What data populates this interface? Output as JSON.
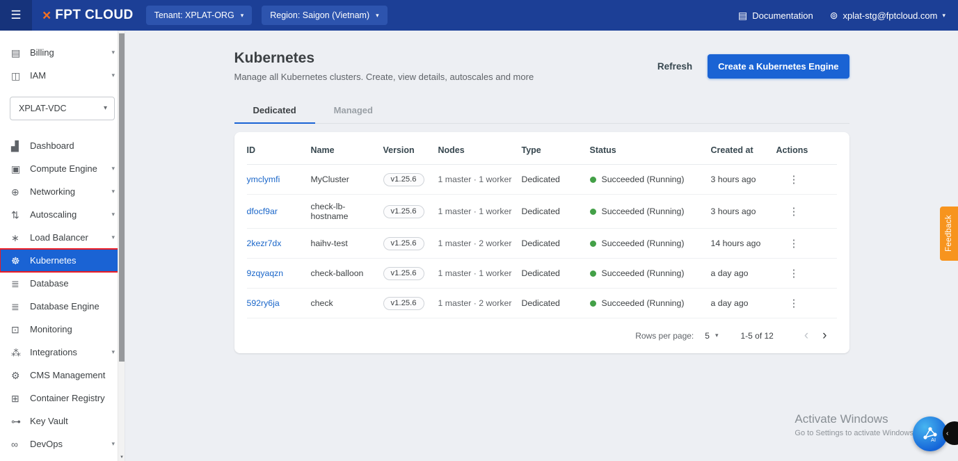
{
  "topbar": {
    "brand": "FPT CLOUD",
    "tenant": "Tenant: XPLAT-ORG",
    "region": "Region: Saigon (Vietnam)",
    "documentation": "Documentation",
    "account": "xplat-stg@fptcloud.com"
  },
  "sidebar": {
    "top_items": [
      {
        "label": "Billing",
        "icon": "billing-icon",
        "expandable": true
      },
      {
        "label": "IAM",
        "icon": "iam-icon",
        "expandable": true
      }
    ],
    "vdc_selector": "XPLAT-VDC",
    "items": [
      {
        "label": "Dashboard",
        "icon": "dashboard-icon"
      },
      {
        "label": "Compute Engine",
        "icon": "compute-icon",
        "expandable": true
      },
      {
        "label": "Networking",
        "icon": "networking-icon",
        "expandable": true
      },
      {
        "label": "Autoscaling",
        "icon": "autoscaling-icon",
        "expandable": true
      },
      {
        "label": "Load Balancer",
        "icon": "loadbalancer-icon",
        "expandable": true
      },
      {
        "label": "Kubernetes",
        "icon": "kubernetes-icon",
        "active": true
      },
      {
        "label": "Database",
        "icon": "database-icon"
      },
      {
        "label": "Database Engine",
        "icon": "database-engine-icon"
      },
      {
        "label": "Monitoring",
        "icon": "monitoring-icon"
      },
      {
        "label": "Integrations",
        "icon": "integrations-icon",
        "expandable": true
      },
      {
        "label": "CMS Management",
        "icon": "cms-icon"
      },
      {
        "label": "Container Registry",
        "icon": "container-registry-icon"
      },
      {
        "label": "Key Vault",
        "icon": "keyvault-icon"
      },
      {
        "label": "DevOps",
        "icon": "devops-icon",
        "expandable": true
      }
    ]
  },
  "main": {
    "title": "Kubernetes",
    "subtitle": "Manage all Kubernetes clusters. Create, view details, autoscales and more",
    "refresh_label": "Refresh",
    "create_label": "Create a Kubernetes Engine",
    "tabs": [
      {
        "label": "Dedicated",
        "active": true
      },
      {
        "label": "Managed",
        "active": false
      }
    ],
    "table": {
      "columns": [
        "ID",
        "Name",
        "Version",
        "Nodes",
        "Type",
        "Status",
        "Created at",
        "Actions"
      ],
      "rows": [
        {
          "id": "ymclymfi",
          "name": "MyCluster",
          "version": "v1.25.6",
          "nodes": "1 master · 1 worker",
          "type": "Dedicated",
          "status": "Succeeded (Running)",
          "created": "3 hours ago"
        },
        {
          "id": "dfocf9ar",
          "name": "check-lb-hostname",
          "version": "v1.25.6",
          "nodes": "1 master · 1 worker",
          "type": "Dedicated",
          "status": "Succeeded (Running)",
          "created": "3 hours ago"
        },
        {
          "id": "2kezr7dx",
          "name": "haihv-test",
          "version": "v1.25.6",
          "nodes": "1 master · 2 worker",
          "type": "Dedicated",
          "status": "Succeeded (Running)",
          "created": "14 hours ago"
        },
        {
          "id": "9zqyaqzn",
          "name": "check-balloon",
          "version": "v1.25.6",
          "nodes": "1 master · 1 worker",
          "type": "Dedicated",
          "status": "Succeeded (Running)",
          "created": "a day ago"
        },
        {
          "id": "592ry6ja",
          "name": "check",
          "version": "v1.25.6",
          "nodes": "1 master · 2 worker",
          "type": "Dedicated",
          "status": "Succeeded (Running)",
          "created": "a day ago"
        }
      ],
      "pagination": {
        "rows_per_page_label": "Rows per page:",
        "rows_per_page_value": "5",
        "range": "1-5 of 12"
      }
    }
  },
  "feedback_label": "Feedback",
  "watermark": {
    "title": "Activate Windows",
    "subtitle": "Go to Settings to activate Windows"
  },
  "fab": {
    "ai_label": "AI"
  },
  "icon_glyphs": {
    "hamburger-icon": "☰",
    "brand-mark-icon": "×",
    "caret-down-icon": "▾",
    "chevron-down-icon": "▾",
    "documentation-icon": "▤",
    "account-icon": "⊚",
    "billing-icon": "▤",
    "iam-icon": "◫",
    "dashboard-icon": "▟",
    "compute-icon": "▣",
    "networking-icon": "⊕",
    "autoscaling-icon": "⇅",
    "loadbalancer-icon": "∗",
    "kubernetes-icon": "☸",
    "database-icon": "≣",
    "database-engine-icon": "≣",
    "monitoring-icon": "⊡",
    "integrations-icon": "⁂",
    "cms-icon": "⚙",
    "container-registry-icon": "⊞",
    "keyvault-icon": "⊶",
    "devops-icon": "∞",
    "actions-icon": "⋮",
    "prev-icon": "‹",
    "next-icon": "›",
    "scroll-down-icon": "▾",
    "edge-collapse-icon": "‹"
  },
  "colors": {
    "topbar_bg": "#1c3f96",
    "pill_bg": "#2d54ae",
    "primary_blue": "#1a63d4",
    "link_blue": "#1a66c9",
    "status_green": "#43a047",
    "brand_orange": "#f36f21",
    "feedback_orange": "#f7941e",
    "annotation_red": "#ec1c24",
    "page_bg": "#edeff3"
  }
}
